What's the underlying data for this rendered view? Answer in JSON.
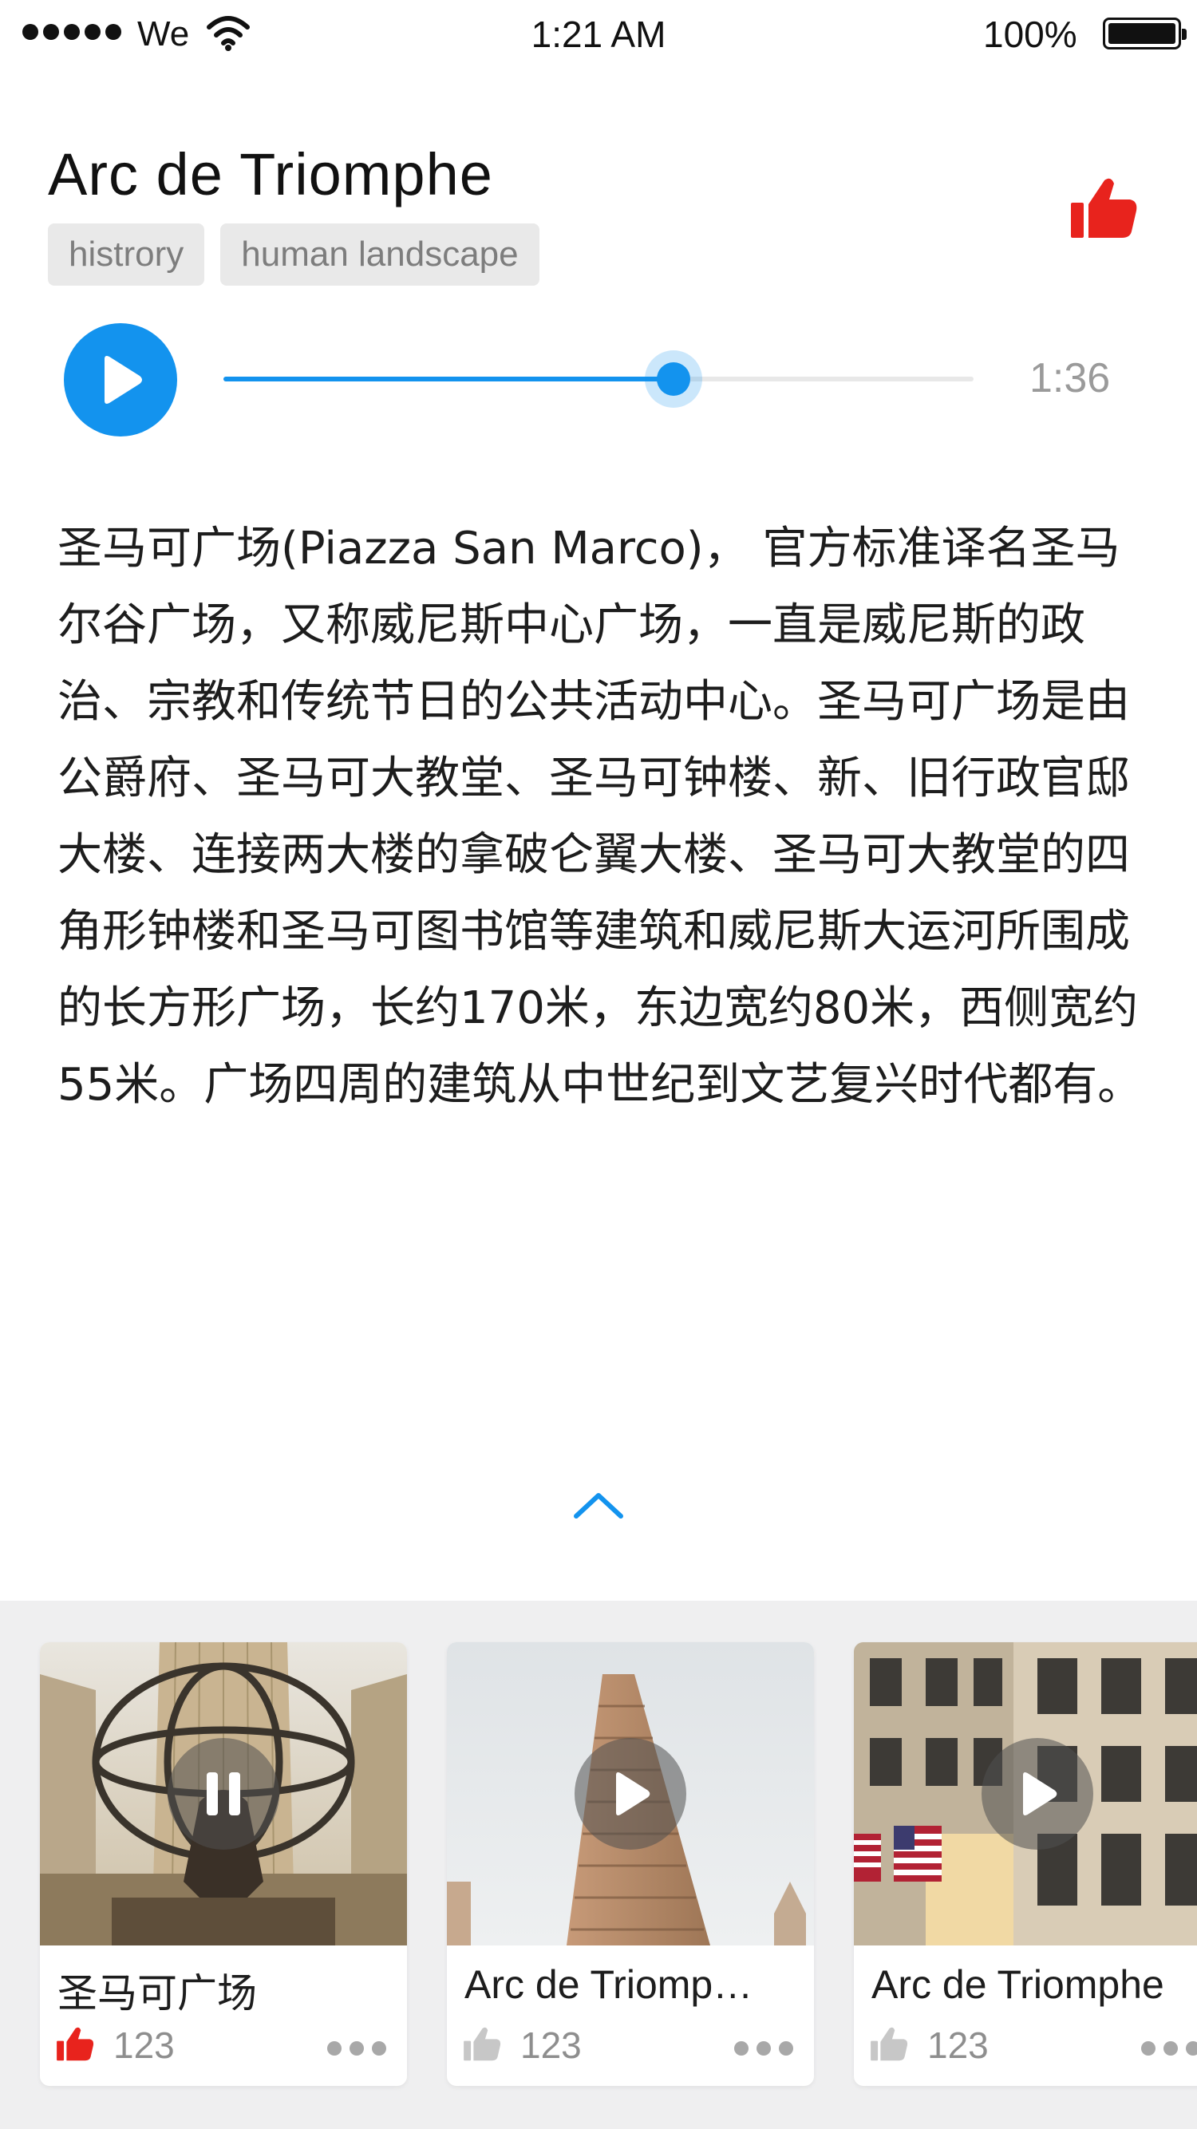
{
  "status_bar": {
    "carrier": "We",
    "time": "1:21 AM",
    "battery": "100%",
    "icons": [
      "signal-dots-icon",
      "wifi-icon",
      "battery-icon"
    ]
  },
  "header": {
    "title": "Arc de Triomphe",
    "tags": [
      "histrory",
      "human landscape"
    ],
    "like_icon": "thumbs-up-icon",
    "liked": true
  },
  "player": {
    "play_icon": "play-icon",
    "progress": 0.6,
    "duration": "1:36"
  },
  "description": "圣马可广场(Piazza San Marco)， 官方标准译名圣马尔谷广场，又称威尼斯中心广场，一直是威尼斯的政治、宗教和传统节日的公共活动中心。圣马可广场是由公爵府、圣马可大教堂、圣马可钟楼、新、旧行政官邸大楼、连接两大楼的拿破仑翼大楼、圣马可大教堂的四角形钟楼和圣马可图书馆等建筑和威尼斯大运河所围成的长方形广场，长约170米，东边宽约80米，西侧宽约55米。广场四周的建筑从中世纪到文艺复兴时代都有。",
  "expand_icon": "chevron-up-icon",
  "cards": [
    {
      "title": "圣马可广场",
      "likes": "123",
      "liked": true,
      "state_icon": "pause-icon"
    },
    {
      "title": "Arc de Triomp…",
      "likes": "123",
      "liked": false,
      "state_icon": "play-icon"
    },
    {
      "title": "Arc de Triomphe",
      "likes": "123",
      "liked": false,
      "state_icon": "play-icon"
    }
  ],
  "colors": {
    "accent": "#1393ee",
    "like_active": "#e8231d",
    "like_inactive": "#c7c7c7",
    "panel_bg": "#efeff0"
  }
}
